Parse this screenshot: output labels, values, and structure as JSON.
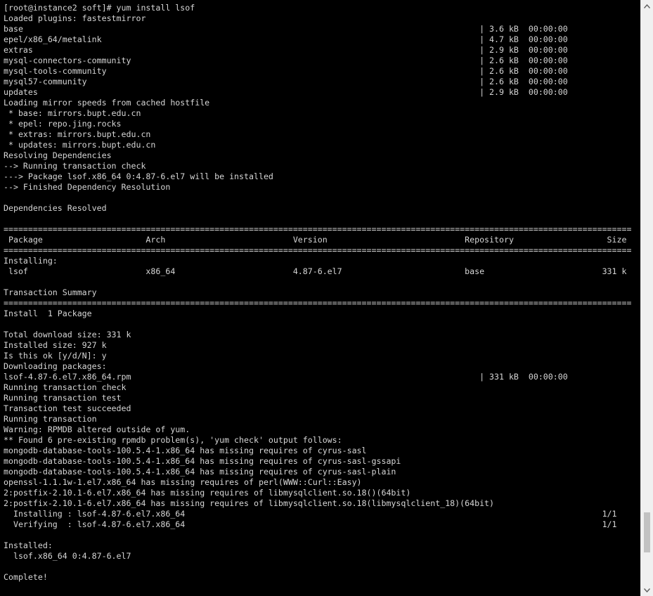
{
  "terminal": {
    "lines": [
      "[root@instance2 soft]# yum install lsof",
      "Loaded plugins: fastestmirror",
      "base                                                                                             | 3.6 kB  00:00:00",
      "epel/x86_64/metalink                                                                             | 4.7 kB  00:00:00",
      "extras                                                                                           | 2.9 kB  00:00:00",
      "mysql-connectors-community                                                                       | 2.6 kB  00:00:00",
      "mysql-tools-community                                                                            | 2.6 kB  00:00:00",
      "mysql57-community                                                                                | 2.6 kB  00:00:00",
      "updates                                                                                          | 2.9 kB  00:00:00",
      "Loading mirror speeds from cached hostfile",
      " * base: mirrors.bupt.edu.cn",
      " * epel: repo.jing.rocks",
      " * extras: mirrors.bupt.edu.cn",
      " * updates: mirrors.bupt.edu.cn",
      "Resolving Dependencies",
      "--> Running transaction check",
      "---> Package lsof.x86_64 0:4.87-6.el7 will be installed",
      "--> Finished Dependency Resolution",
      "",
      "Dependencies Resolved",
      "",
      "================================================================================================================================",
      " Package                     Arch                          Version                            Repository                   Size",
      "================================================================================================================================",
      "Installing:",
      " lsof                        x86_64                        4.87-6.el7                         base                        331 k",
      "",
      "Transaction Summary",
      "================================================================================================================================",
      "Install  1 Package",
      "",
      "Total download size: 331 k",
      "Installed size: 927 k",
      "Is this ok [y/d/N]: y",
      "Downloading packages:",
      "lsof-4.87-6.el7.x86_64.rpm                                                                       | 331 kB  00:00:00",
      "Running transaction check",
      "Running transaction test",
      "Transaction test succeeded",
      "Running transaction",
      "Warning: RPMDB altered outside of yum.",
      "** Found 6 pre-existing rpmdb problem(s), 'yum check' output follows:",
      "mongodb-database-tools-100.5.4-1.x86_64 has missing requires of cyrus-sasl",
      "mongodb-database-tools-100.5.4-1.x86_64 has missing requires of cyrus-sasl-gssapi",
      "mongodb-database-tools-100.5.4-1.x86_64 has missing requires of cyrus-sasl-plain",
      "openssl-1.1.1w-1.el7.x86_64 has missing requires of perl(WWW::Curl::Easy)",
      "2:postfix-2.10.1-6.el7.x86_64 has missing requires of libmysqlclient.so.18()(64bit)",
      "2:postfix-2.10.1-6.el7.x86_64 has missing requires of libmysqlclient.so.18(libmysqlclient_18)(64bit)",
      "  Installing : lsof-4.87-6.el7.x86_64                                                                                     1/1",
      "  Verifying  : lsof-4.87-6.el7.x86_64                                                                                     1/1",
      "",
      "Installed:",
      "  lsof.x86_64 0:4.87-6.el7",
      "",
      "Complete!"
    ]
  },
  "colors": {
    "background": "#000000",
    "foreground": "#d6d6d6",
    "scrollbar_track": "#f0f0f0",
    "scrollbar_thumb": "#c2c2c2"
  },
  "scroll_position": 0.94
}
